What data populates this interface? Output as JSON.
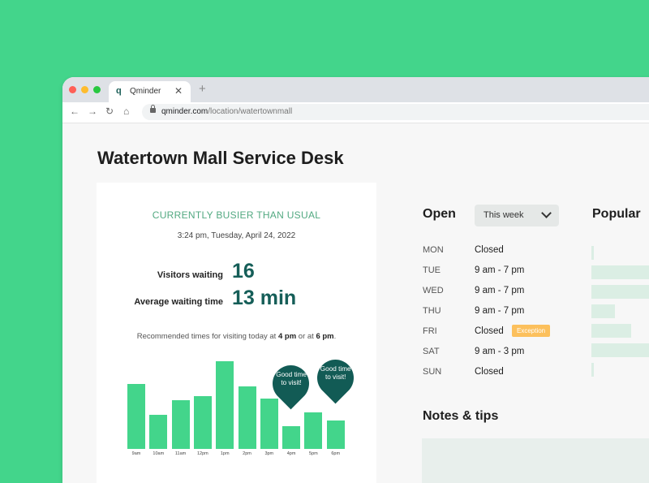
{
  "browser": {
    "tab_title": "Qminder",
    "tab_logo": "q",
    "url_domain": "qminder.com",
    "url_path": "/location/watertownmall"
  },
  "page": {
    "title": "Watertown Mall Service Desk"
  },
  "status": {
    "headline": "CURRENTLY BUSIER THAN USUAL",
    "timestamp": "3:24 pm, Tuesday,  April 24, 2022",
    "visitors_label": "Visitors waiting",
    "visitors_value": "16",
    "avg_label": "Average waiting time",
    "avg_value": "13 min",
    "reco_prefix": "Recommended times for visiting today at ",
    "reco_time1": "4 pm",
    "reco_mid": " or at ",
    "reco_time2": "6 pm",
    "reco_suffix": "."
  },
  "chart_data": {
    "type": "bar",
    "categories": [
      "9am",
      "10am",
      "11am",
      "12pm",
      "1pm",
      "2pm",
      "3pm",
      "4pm",
      "5pm",
      "6pm"
    ],
    "values": [
      80,
      42,
      60,
      65,
      108,
      77,
      62,
      28,
      45,
      35
    ],
    "forecast_from_index": 6,
    "ylim": [
      0,
      110
    ],
    "annotations": [
      {
        "category": "4pm",
        "text": "Good time to visit!"
      },
      {
        "category": "6pm",
        "text": "Good time to visit!"
      }
    ]
  },
  "schedule": {
    "heading": "Open",
    "period_select": "This week",
    "days": [
      {
        "day": "MON",
        "hours": "Closed"
      },
      {
        "day": "TUE",
        "hours": "9 am - 7 pm"
      },
      {
        "day": "WED",
        "hours": "9 am - 7 pm"
      },
      {
        "day": "THU",
        "hours": "9 am - 7 pm"
      },
      {
        "day": "FRI",
        "hours": "Closed",
        "badge": "Exception"
      },
      {
        "day": "SAT",
        "hours": "9 am - 3 pm"
      },
      {
        "day": "SUN",
        "hours": "Closed"
      }
    ]
  },
  "popular": {
    "heading": "Popular"
  },
  "notes": {
    "heading": "Notes & tips"
  },
  "colors": {
    "accent": "#43d58b",
    "dark": "#155e58",
    "badge": "#fcc05c"
  }
}
